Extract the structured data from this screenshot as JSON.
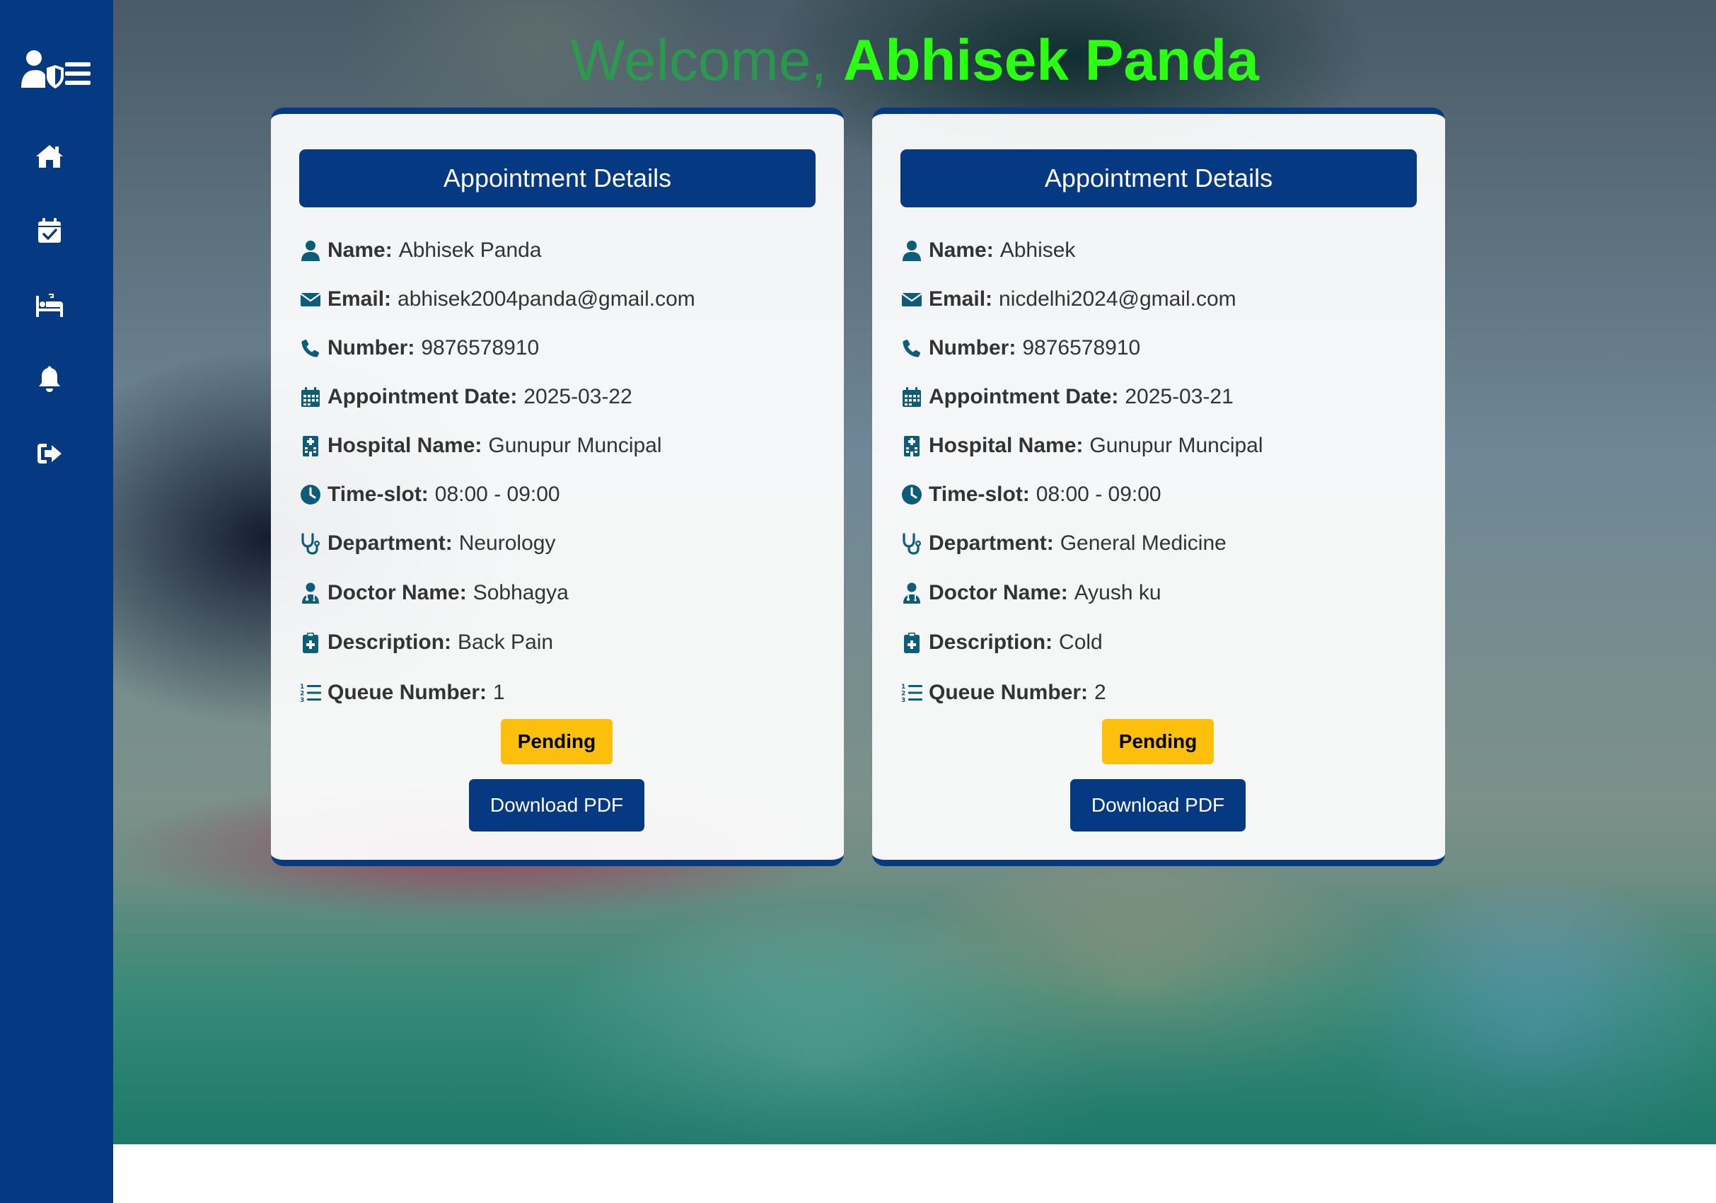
{
  "sidebar": {
    "logo_icon": "doctor-shield-menu-icon",
    "items": [
      {
        "icon": "home-icon"
      },
      {
        "icon": "calendar-check-icon"
      },
      {
        "icon": "hospital-bed-icon"
      },
      {
        "icon": "bell-icon"
      },
      {
        "icon": "sign-out-icon"
      }
    ],
    "color": "#053a82"
  },
  "header": {
    "welcome_label": "Welcome,",
    "user_name": "Abhisek Panda"
  },
  "labels": {
    "name": "Name:",
    "email": "Email:",
    "number": "Number:",
    "appointment_date": "Appointment Date:",
    "hospital_name": "Hospital Name:",
    "time_slot": "Time-slot:",
    "department": "Department:",
    "doctor_name": "Doctor Name:",
    "description": "Description:",
    "queue_number": "Queue Number:"
  },
  "appointments": [
    {
      "title": "Appointment Details",
      "name": "Abhisek Panda",
      "email": "abhisek2004panda@gmail.com",
      "number": "9876578910",
      "appointment_date": "2025-03-22",
      "hospital_name": "Gunupur Muncipal",
      "time_slot": "08:00 - 09:00",
      "department": "Neurology",
      "doctor_name": "Sobhagya",
      "description": "Back Pain",
      "queue_number": "1",
      "status": "Pending",
      "download_label": "Download PDF"
    },
    {
      "title": "Appointment Details",
      "name": "Abhisek",
      "email": "nicdelhi2024@gmail.com",
      "number": "9876578910",
      "appointment_date": "2025-03-21",
      "hospital_name": "Gunupur Muncipal",
      "time_slot": "08:00 - 09:00",
      "department": "General Medicine",
      "doctor_name": "Ayush ku",
      "description": "Cold",
      "queue_number": "2",
      "status": "Pending",
      "download_label": "Download PDF"
    }
  ],
  "colors": {
    "primary": "#053a82",
    "accent_name": "#2bff14",
    "welcome_label": "#1faa45",
    "status_pending": "#fbbf0c",
    "icon": "#0d5c7a"
  }
}
